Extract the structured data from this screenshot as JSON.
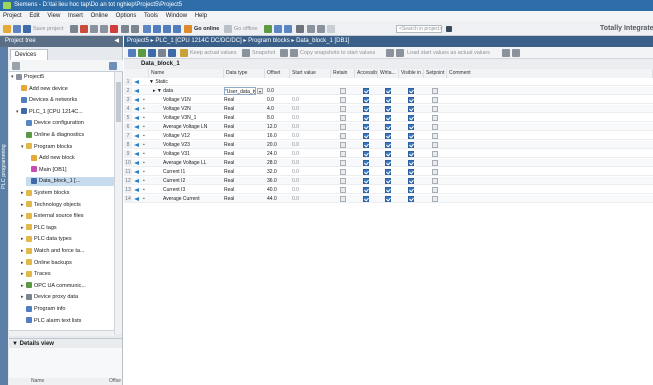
{
  "window": {
    "title": "Siemens - D:\\tai lieu hoc tap\\Do an tot nghiep\\Project5\\Project5"
  },
  "menu": [
    "Project",
    "Edit",
    "View",
    "Insert",
    "Online",
    "Options",
    "Tools",
    "Window",
    "Help"
  ],
  "toolbar": {
    "save_project": "Save project",
    "go_online": "Go online",
    "go_offline": "Go offline",
    "search_placeholder": "<Search in project>",
    "brand": "Totally Integrate"
  },
  "left_panel": {
    "title": "Project tree",
    "vertical_label": "PLC programming",
    "devices_tab": "Devices",
    "tree": [
      {
        "label": "Project5",
        "icon": "project-icon",
        "depth": 0,
        "arrow": "down"
      },
      {
        "label": "Add new device",
        "icon": "add-device-icon",
        "depth": 1,
        "arrow": ""
      },
      {
        "label": "Devices & networks",
        "icon": "network-icon",
        "depth": 1,
        "arrow": ""
      },
      {
        "label": "PLC_1 [CPU 1214C...",
        "icon": "plc-icon",
        "depth": 1,
        "arrow": "down"
      },
      {
        "label": "Device configuration",
        "icon": "config-icon",
        "depth": 2,
        "arrow": ""
      },
      {
        "label": "Online & diagnostics",
        "icon": "diagnostics-icon",
        "depth": 2,
        "arrow": ""
      },
      {
        "label": "Program blocks",
        "icon": "folder-icon",
        "depth": 2,
        "arrow": "down"
      },
      {
        "label": "Add new block",
        "icon": "add-block-icon",
        "depth": 3,
        "arrow": ""
      },
      {
        "label": "Main [OB1]",
        "icon": "ob-icon",
        "depth": 3,
        "arrow": ""
      },
      {
        "label": "Data_block_1 [...",
        "icon": "db-icon",
        "depth": 3,
        "arrow": "",
        "selected": true
      },
      {
        "label": "System blocks",
        "icon": "folder-icon",
        "depth": 2,
        "arrow": "right"
      },
      {
        "label": "Technology objects",
        "icon": "folder-icon",
        "depth": 2,
        "arrow": "right"
      },
      {
        "label": "External source files",
        "icon": "folder-icon",
        "depth": 2,
        "arrow": "right"
      },
      {
        "label": "PLC tags",
        "icon": "folder-icon",
        "depth": 2,
        "arrow": "right"
      },
      {
        "label": "PLC data types",
        "icon": "folder-icon",
        "depth": 2,
        "arrow": "right"
      },
      {
        "label": "Watch and force ta...",
        "icon": "folder-icon",
        "depth": 2,
        "arrow": "right"
      },
      {
        "label": "Online backups",
        "icon": "folder-icon",
        "depth": 2,
        "arrow": "right"
      },
      {
        "label": "Traces",
        "icon": "folder-icon",
        "depth": 2,
        "arrow": "right"
      },
      {
        "label": "OPC UA communic...",
        "icon": "opc-icon",
        "depth": 2,
        "arrow": "right"
      },
      {
        "label": "Device proxy data",
        "icon": "proxy-icon",
        "depth": 2,
        "arrow": "right"
      },
      {
        "label": "Program info",
        "icon": "info-icon",
        "depth": 2,
        "arrow": ""
      },
      {
        "label": "PLC alarm text lists",
        "icon": "alarm-icon",
        "depth": 2,
        "arrow": ""
      }
    ],
    "details_view": "Details view",
    "details_columns": [
      "Name",
      "Offse"
    ]
  },
  "breadcrumb": "Project5 ▸ PLC_1 [CPU 1214C DC/DC/DC] ▸ Program blocks ▸ Data_block_1 [DB1]",
  "editor_toolbar": {
    "keep_actual": "Keep actual values",
    "snapshot": "Snapshot",
    "copy_snapshots": "Copy snapshots to start values",
    "load_start": "Load start values as actual values"
  },
  "block_title": "Data_block_1",
  "columns": [
    "Name",
    "Data type",
    "Offset",
    "Start value",
    "Retain",
    "Accessible f...",
    "Writa...",
    "Visible in ...",
    "Setpoint",
    "Comment"
  ],
  "rows": [
    {
      "num": "1",
      "name": "▼ Static",
      "indent": 0,
      "type": "",
      "offset": "",
      "start": "",
      "flags": null
    },
    {
      "num": "2",
      "name": "▸ ▼ data",
      "indent": 1,
      "type": "\"User_data_type...",
      "offset": "0.0",
      "start": "",
      "flags": [
        false,
        true,
        true,
        true,
        false
      ]
    },
    {
      "num": "3",
      "name": "Voltage V1N",
      "indent": 2,
      "type": "Real",
      "offset": "0.0",
      "start": "0.0",
      "flags": [
        false,
        true,
        true,
        true,
        false
      ]
    },
    {
      "num": "4",
      "name": "Voltage V2N",
      "indent": 2,
      "type": "Real",
      "offset": "4.0",
      "start": "0.0",
      "flags": [
        false,
        true,
        true,
        true,
        false
      ]
    },
    {
      "num": "5",
      "name": "Voltage V3N_1",
      "indent": 2,
      "type": "Real",
      "offset": "8.0",
      "start": "0.0",
      "flags": [
        false,
        true,
        true,
        true,
        false
      ]
    },
    {
      "num": "6",
      "name": "Average Voltage LN",
      "indent": 2,
      "type": "Real",
      "offset": "12.0",
      "start": "0.0",
      "flags": [
        false,
        true,
        true,
        true,
        false
      ]
    },
    {
      "num": "7",
      "name": "Voltage V12",
      "indent": 2,
      "type": "Real",
      "offset": "16.0",
      "start": "0.0",
      "flags": [
        false,
        true,
        true,
        true,
        false
      ]
    },
    {
      "num": "8",
      "name": "Voltage V23",
      "indent": 2,
      "type": "Real",
      "offset": "20.0",
      "start": "0.0",
      "flags": [
        false,
        true,
        true,
        true,
        false
      ]
    },
    {
      "num": "9",
      "name": "Voltage V31",
      "indent": 2,
      "type": "Real",
      "offset": "24.0",
      "start": "0.0",
      "flags": [
        false,
        true,
        true,
        true,
        false
      ]
    },
    {
      "num": "10",
      "name": "Average Voltage LL",
      "indent": 2,
      "type": "Real",
      "offset": "28.0",
      "start": "0.0",
      "flags": [
        false,
        true,
        true,
        true,
        false
      ]
    },
    {
      "num": "11",
      "name": "Current I1",
      "indent": 2,
      "type": "Real",
      "offset": "32.0",
      "start": "0.0",
      "flags": [
        false,
        true,
        true,
        true,
        false
      ]
    },
    {
      "num": "12",
      "name": "Current I2",
      "indent": 2,
      "type": "Real",
      "offset": "36.0",
      "start": "0.0",
      "flags": [
        false,
        true,
        true,
        true,
        false
      ]
    },
    {
      "num": "13",
      "name": "Current I3",
      "indent": 2,
      "type": "Real",
      "offset": "40.0",
      "start": "0.0",
      "flags": [
        false,
        true,
        true,
        true,
        false
      ]
    },
    {
      "num": "14",
      "name": "Average Current",
      "indent": 2,
      "type": "Real",
      "offset": "44.0",
      "start": "0.0",
      "flags": [
        false,
        true,
        true,
        true,
        false
      ]
    }
  ],
  "colors": {
    "titlebar": "#2f6da8",
    "breadcrumb": "#3a5f88",
    "checkbox_on": "#3b78c2",
    "selected_row": "#c7dbef"
  }
}
